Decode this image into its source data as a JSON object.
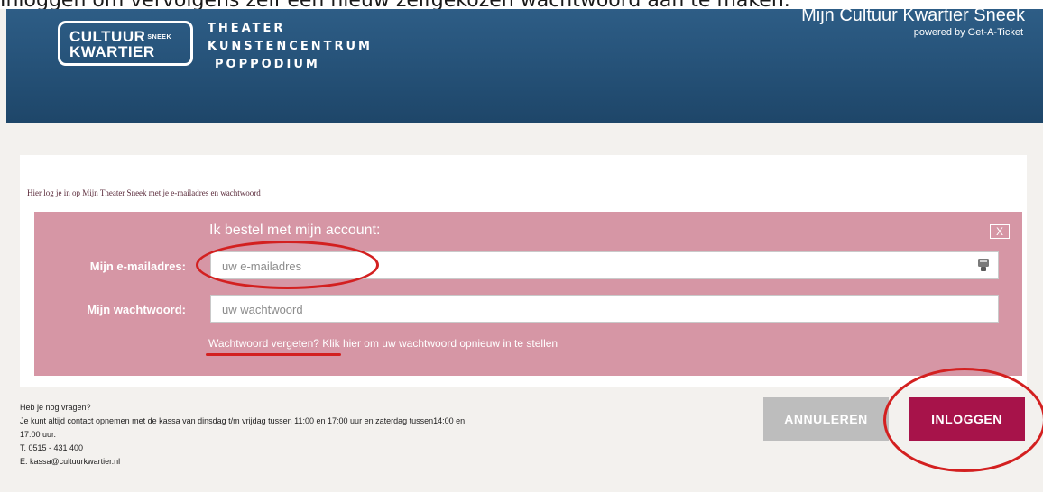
{
  "caption": "Inloggen om vervolgens zelf een nieuw zelfgekozen wachtwoord aan te maken.",
  "header": {
    "logo": {
      "line1": "CULTUUR",
      "sneek": "SNEEK",
      "line2": "KWARTIER",
      "words": [
        "THEATER",
        "KUNSTENCENTRUM",
        "POPPODIUM"
      ]
    },
    "title": "Mijn Cultuur Kwartier Sneek",
    "subtitle": "powered by Get-A-Ticket"
  },
  "intro": "Hier log je in op Mijn Theater Sneek met je e-mailadres en wachtwoord",
  "login": {
    "heading": "Ik bestel met mijn account:",
    "close_label": "X",
    "email_label": "Mijn e-mailadres:",
    "email_placeholder": "uw e-mailadres",
    "email_value": "",
    "password_label": "Mijn wachtwoord:",
    "password_placeholder": "uw wachtwoord",
    "password_value": "",
    "forgot_text": "Wachtwoord vergeten? Klik hier om uw wachtwoord opnieuw in te stellen"
  },
  "contact": {
    "line1": "Heb je nog vragen?",
    "line2": "Je kunt altijd contact opnemen met de kassa van dinsdag t/m vrijdag tussen 11:00 en 17:00 uur en zaterdag tussen14:00 en",
    "line3": "17:00 uur.",
    "phone": "T. 0515 - 431 400",
    "email": "E. kassa@cultuurkwartier.nl"
  },
  "buttons": {
    "cancel_label": "ANNULEREN",
    "login_label": "INLOGGEN"
  },
  "icons": {
    "email_field_icon": "keychain-icon"
  },
  "colors": {
    "header_bg": "#27547b",
    "form_bg": "#d696a5",
    "login_button": "#a7134a",
    "cancel_button": "#bdbdbd",
    "annotation": "#d32020"
  }
}
